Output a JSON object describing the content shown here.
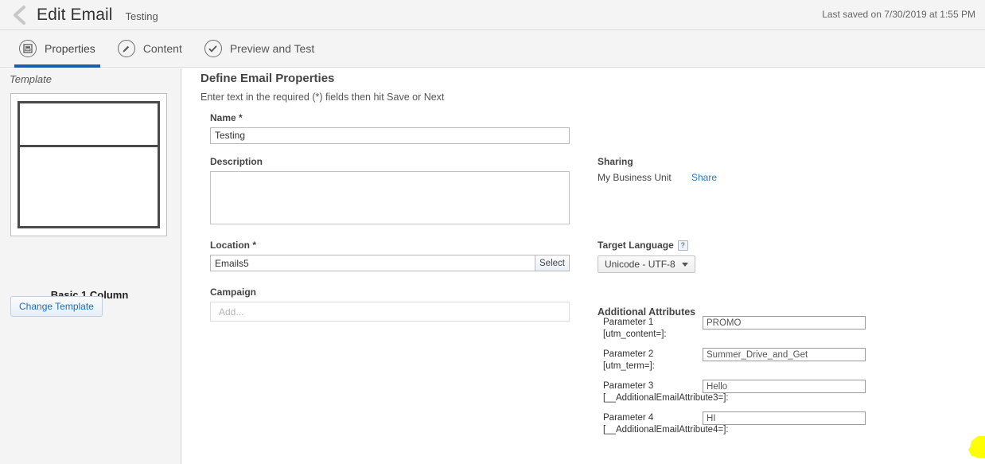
{
  "header": {
    "back_icon": "chevron-left-icon",
    "title": "Edit Email",
    "subtitle": "Testing",
    "last_saved": "Last saved on 7/30/2019 at 1:55 PM"
  },
  "tabs": [
    {
      "label": "Properties",
      "icon": "template-icon",
      "active": true
    },
    {
      "label": "Content",
      "icon": "pencil-icon",
      "active": false
    },
    {
      "label": "Preview and Test",
      "icon": "check-circle-icon",
      "active": false
    }
  ],
  "template_panel": {
    "heading": "Template",
    "name": "Basic 1 Column",
    "change_button": "Change Template"
  },
  "main": {
    "section_title": "Define Email Properties",
    "section_subtitle": "Enter text in the required (*) fields then hit Save or Next",
    "name_label": "Name *",
    "name_value": "Testing",
    "description_label": "Description",
    "description_value": "",
    "location_label": "Location *",
    "location_value": "Emails5",
    "location_select_button": "Select",
    "campaign_label": "Campaign",
    "campaign_value": "",
    "campaign_placeholder": "Add..."
  },
  "right": {
    "sharing_label": "Sharing",
    "sharing_value": "My Business Unit",
    "share_link": "Share",
    "target_language_label": "Target Language",
    "help_icon_glyph": "?",
    "target_language_value": "Unicode - UTF-8",
    "additional_attributes_title": "Additional Attributes",
    "parameters": [
      {
        "line1": "Parameter 1",
        "line2": "[utm_content=]:",
        "value": "PROMO"
      },
      {
        "line1": "Parameter 2",
        "line2": "[utm_term=]:",
        "value": "Summer_Drive_and_Get"
      },
      {
        "line1": "Parameter 3",
        "line2": "[__AdditionalEmailAttribute3=]:",
        "value": "Hello"
      },
      {
        "line1": "Parameter 4",
        "line2": "[__AdditionalEmailAttribute4=]:",
        "value": "HI"
      }
    ]
  },
  "colors": {
    "accent_blue": "#1b5faa",
    "link_blue": "#2a7ac4",
    "highlight_yellow": "#ffff00",
    "chrome_gray": "#f4f4f4"
  }
}
